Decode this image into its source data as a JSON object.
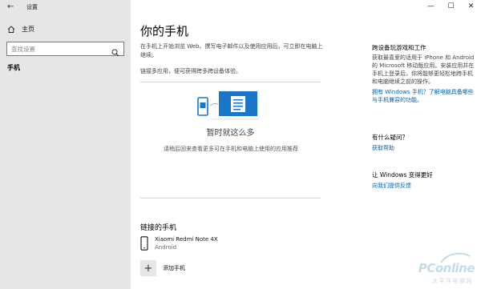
{
  "window": {
    "back_symbol": "←",
    "app_name": "设置",
    "controls": [
      "—",
      "☐",
      "✕"
    ]
  },
  "sidebar": {
    "home_label": "主页",
    "search_placeholder": "查找设置",
    "active_item": "手机"
  },
  "main": {
    "title": "你的手机",
    "intro": "在手机上开始浏览 Web、撰写电子邮件以及使用应用后，可立即在电脑上继续。",
    "link_note": "链接多应用，便可获得跨多跨设备体验。",
    "empty_title": "暂时就这么多",
    "empty_desc": "请稍后回来查看更多可在手机和电脑上使用的应用推荐",
    "linked_title": "链接的手机",
    "device_name": "Xiaomi Redmi Note 4X",
    "device_os": "Android",
    "add_label": "添加手机"
  },
  "right_panel": {
    "section1_title": "跨设备玩游戏和工作",
    "section1_body": "获取最喜爱的适用于 iPhone 和 Android 的 Microsoft 移动版应用。安装应用并在手机上登录后，你将能够更轻松地跨手机和电脑继续之前的操作。",
    "section1_link": "拥有 Windows 手机？了解电脑具备哪些与手机兼容的功能。",
    "section2_title": "有什么疑问？",
    "section2_link": "获取帮助",
    "section3_title": "让 Windows 变得更好",
    "section3_link": "向我们提供反馈"
  },
  "watermark": {
    "brand": "PConline",
    "sub": "太平洋电脑网"
  },
  "colors": {
    "sidebar_bg": "#e6e6e6",
    "accent": "#0063b1",
    "illus_blue": "#1976c9"
  }
}
